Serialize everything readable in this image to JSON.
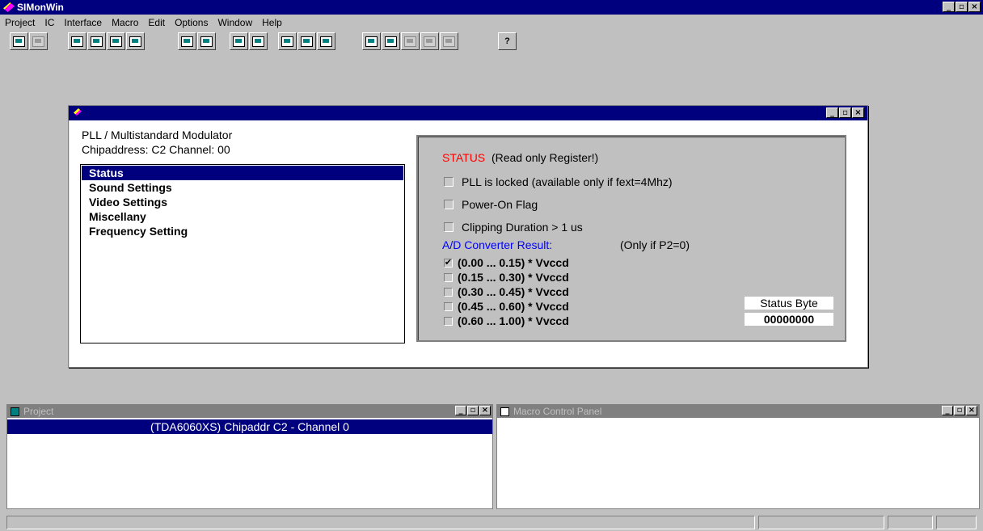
{
  "app": {
    "title": "SIMonWin"
  },
  "menu": [
    "Project",
    "IC",
    "Interface",
    "Macro",
    "Edit",
    "Options",
    "Window",
    "Help"
  ],
  "window_buttons": {
    "minimize": "_",
    "restore": "▫",
    "close": "×"
  },
  "toolbar_extra": {
    "help_glyph": "?"
  },
  "child": {
    "module_title": "PLL / Multistandard Modulator",
    "module_sub": "Chipaddress: C2  Channel: 00",
    "list_items": [
      "Status",
      "Sound Settings",
      "Video Settings",
      "Miscellany",
      "Frequency Setting"
    ],
    "selected_index": 0,
    "status": {
      "heading": "STATUS",
      "heading_note": "(Read only Register!)",
      "flags": [
        {
          "label": "PLL is locked (available only if fext=4Mhz)",
          "checked": false
        },
        {
          "label": "Power-On Flag",
          "checked": false
        },
        {
          "label": "Clipping Duration > 1 us",
          "checked": false
        }
      ],
      "adc_label": "A/D Converter Result:",
      "adc_note": "(Only if P2=0)",
      "adc_ranges": [
        {
          "label": "(0.00 ... 0.15) * Vvccd",
          "checked": true
        },
        {
          "label": "(0.15 ... 0.30) * Vvccd",
          "checked": false
        },
        {
          "label": "(0.30 ... 0.45) * Vvccd",
          "checked": false
        },
        {
          "label": "(0.45 ... 0.60) * Vvccd",
          "checked": false
        },
        {
          "label": "(0.60 ... 1.00) * Vvccd",
          "checked": false
        }
      ],
      "status_byte_label": "Status Byte",
      "status_byte_value": "00000000",
      "check_mark": "✔"
    }
  },
  "project_panel": {
    "title": "Project",
    "row": "(TDA6060XS)  Chipaddr C2 - Channel 0"
  },
  "macro_panel": {
    "title": "Macro Control Panel"
  },
  "colors": {
    "title_active": "#00007f",
    "title_inactive": "#808080",
    "face": "#c0c0c0",
    "red": "#ff0000",
    "blue": "#0000ff"
  }
}
